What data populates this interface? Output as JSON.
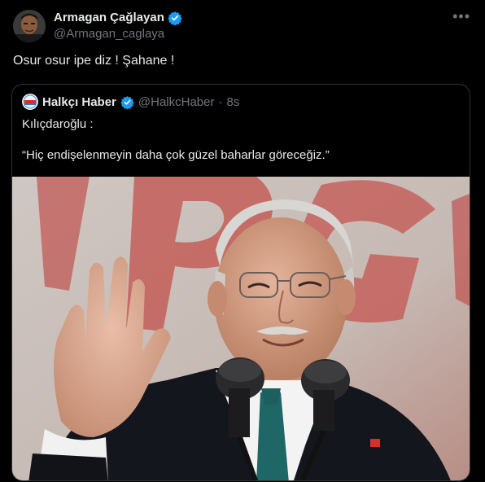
{
  "author": {
    "display_name": "Armagan Çağlayan",
    "handle": "@Armagan_caglaya",
    "verified": true
  },
  "more_icon": "more-horizontal-icon",
  "tweet": {
    "text": "Osur osur ipe diz ! Şahane !"
  },
  "quoted": {
    "display_name": "Halkçı Haber",
    "handle": "@HalkcHaber",
    "separator": "·",
    "time": "8s",
    "line1": "Kılıçdaroğlu :",
    "line2": "“Hiç endişelenmeyin daha çok güzel baharlar göreceğiz.”"
  },
  "colors": {
    "background": "#000000",
    "text": "#e7e9ea",
    "muted": "#71767b",
    "verified": "#1d9bf0",
    "border": "#2f3336"
  }
}
